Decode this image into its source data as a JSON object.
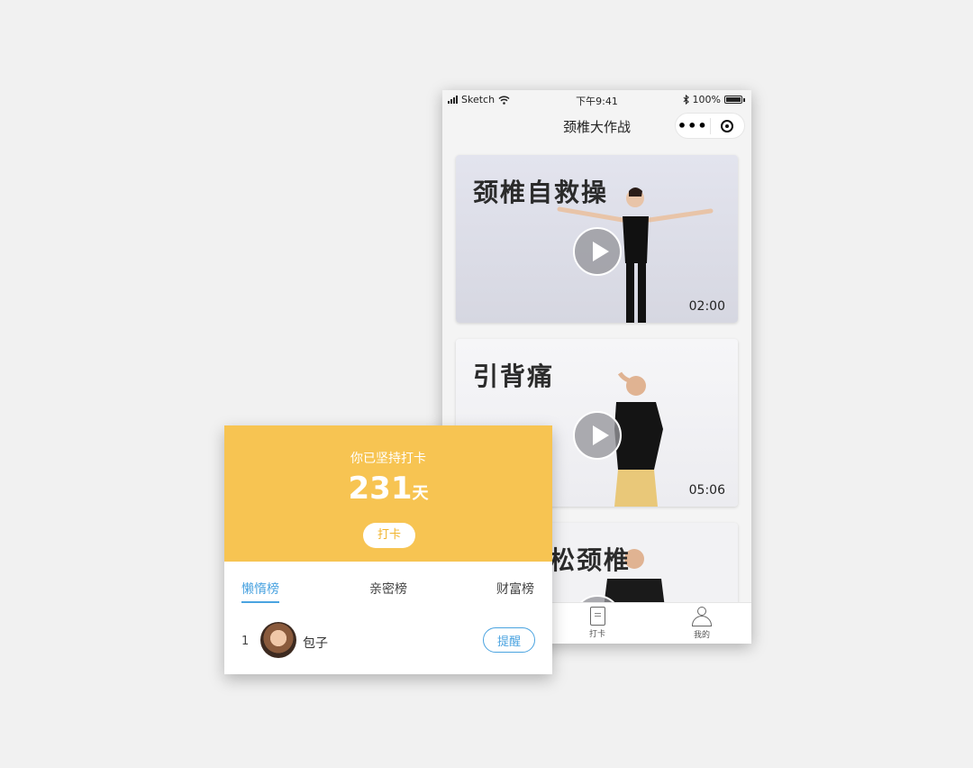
{
  "status_bar": {
    "carrier": "Sketch",
    "time": "下午9:41",
    "battery": "100%"
  },
  "nav": {
    "title": "颈椎大作战",
    "more_label": "•••"
  },
  "videos": [
    {
      "title": "颈椎自救操",
      "duration": "02:00"
    },
    {
      "title": "引背痛",
      "duration": "05:06"
    },
    {
      "title": "松颈椎",
      "duration": ""
    }
  ],
  "tabbar": {
    "checkin": "打卡",
    "mine": "我的"
  },
  "panel": {
    "streak_label": "你已坚持打卡",
    "streak_days": "231",
    "streak_unit": "天",
    "checkin_button": "打卡",
    "tabs": [
      "懒惰榜",
      "亲密榜",
      "财富榜"
    ],
    "rows": [
      {
        "rank": "1",
        "name": "包子",
        "action": "提醒"
      }
    ]
  },
  "colors": {
    "accent_yellow": "#f7c452",
    "accent_blue": "#4aa3e0"
  }
}
